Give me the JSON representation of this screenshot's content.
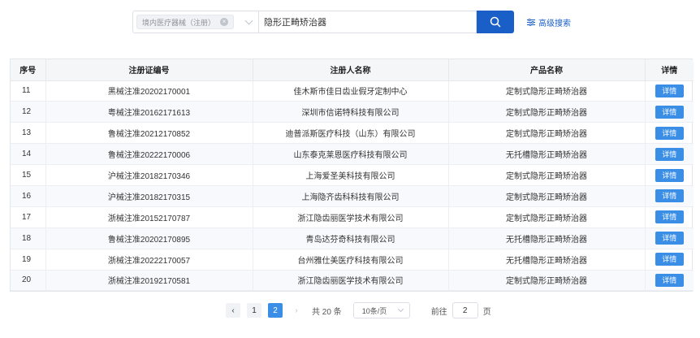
{
  "search": {
    "category_tag": "境内医疗器械（注册）",
    "query": "隐形正畸矫治器",
    "advanced_label": "高级搜索"
  },
  "table": {
    "headers": [
      "序号",
      "注册证编号",
      "注册人名称",
      "产品名称",
      "详情"
    ],
    "rows": [
      {
        "idx": "11",
        "reg_no": "黑械注准20202170001",
        "registrant": "佳木斯市佳日齿业假牙定制中心",
        "product": "定制式隐形正畸矫治器",
        "detail": "详情"
      },
      {
        "idx": "12",
        "reg_no": "粤械注准20162171613",
        "registrant": "深圳市信诺特科技有限公司",
        "product": "定制式隐形正畸矫治器",
        "detail": "详情"
      },
      {
        "idx": "13",
        "reg_no": "鲁械注准20212170852",
        "registrant": "迪普派斯医疗科技（山东）有限公司",
        "product": "定制式隐形正畸矫治器",
        "detail": "详情"
      },
      {
        "idx": "14",
        "reg_no": "鲁械注准20222170006",
        "registrant": "山东泰克莱恩医疗科技有限公司",
        "product": "无托槽隐形正畸矫治器",
        "detail": "详情"
      },
      {
        "idx": "15",
        "reg_no": "沪械注准20182170346",
        "registrant": "上海爱圣美科技有限公司",
        "product": "定制式隐形正畸矫治器",
        "detail": "详情"
      },
      {
        "idx": "16",
        "reg_no": "沪械注准20182170315",
        "registrant": "上海隐齐齿科科技有限公司",
        "product": "定制式隐形正畸矫治器",
        "detail": "详情"
      },
      {
        "idx": "17",
        "reg_no": "浙械注准20152170787",
        "registrant": "浙江隐齿丽医学技术有限公司",
        "product": "定制式隐形正畸矫治器",
        "detail": "详情"
      },
      {
        "idx": "18",
        "reg_no": "鲁械注准20202170895",
        "registrant": "青岛达芬奇科技有限公司",
        "product": "无托槽隐形正畸矫治器",
        "detail": "详情"
      },
      {
        "idx": "19",
        "reg_no": "浙械注准20222170057",
        "registrant": "台州雅仕美医疗科技有限公司",
        "product": "无托槽隐形正畸矫治器",
        "detail": "详情"
      },
      {
        "idx": "20",
        "reg_no": "浙械注准20192170581",
        "registrant": "浙江隐齿丽医学技术有限公司",
        "product": "定制式隐形正畸矫治器",
        "detail": "详情"
      }
    ]
  },
  "pagination": {
    "pages": [
      "1",
      "2"
    ],
    "current_page": "2",
    "total_text": "共 20 条",
    "page_size": "10条/页",
    "goto_label": "前往",
    "goto_value": "2",
    "page_unit": "页"
  },
  "colors": {
    "primary": "#1a5fc8",
    "button_blue": "#3a8ee6"
  }
}
